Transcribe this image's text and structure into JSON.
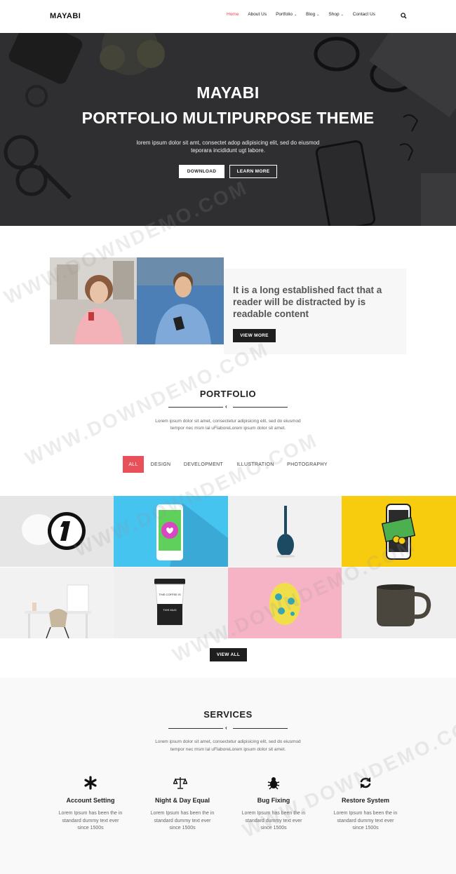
{
  "header": {
    "logo": "MAYABI",
    "nav": [
      {
        "label": "Home",
        "active": true,
        "has_caret": false
      },
      {
        "label": "About Us",
        "active": false,
        "has_caret": false
      },
      {
        "label": "Portfolio",
        "active": false,
        "has_caret": true
      },
      {
        "label": "Blog",
        "active": false,
        "has_caret": true
      },
      {
        "label": "Shop",
        "active": false,
        "has_caret": true
      },
      {
        "label": "Contact Us",
        "active": false,
        "has_caret": false
      }
    ],
    "search_icon": "search-icon",
    "caret_glyph": "⌄"
  },
  "hero": {
    "title_line1": "MAYABI",
    "title_line2": "PORTFOLIO MULTIPURPOSE THEME",
    "subtitle_line1": "lorem ipsum dolor sit amt, consectet adop adipisicing elit, sed do eiusmod",
    "subtitle_line2": "teporara incididunt ugt labore.",
    "download_label": "DOWNLOAD",
    "learn_more_label": "LEARN MORE"
  },
  "about": {
    "text": "It is a long established fact that a reader will be distracted by is readable content",
    "button_label": "VIEW MORE"
  },
  "portfolio": {
    "title": "PORTFOLIO",
    "desc_line1": "Lorem ipsum dolor sit amet, consectetur adipisicing elit, sed do eiusmod",
    "desc_line2": "tempor nec msm lal uFlaboreLorem ipsum dolor sit amet.",
    "filters": [
      "ALL",
      "DESIGN",
      "DEVELOPMENT",
      "ILLUSTRATION",
      "PHOTOGRAPHY"
    ],
    "active_filter": "ALL",
    "view_all_label": "VIEW ALL",
    "tile_colors": [
      "#e6e6e6",
      "#44c4ef",
      "#f1f1f1",
      "#f8cc0e",
      "#f2f2f2",
      "#efefef",
      "#f7b3c6",
      "#efefef"
    ]
  },
  "services": {
    "title": "SERVICES",
    "desc_line1": "Lorem ipsum dolor sit amet, consectetur adipisicing elit, sed do eiusmod",
    "desc_line2": "tempor nec msm lal uFlaboreLorem ipsum dolor sit amet.",
    "items": [
      {
        "title": "Account Setting",
        "icon": "asterisk-icon",
        "text_line1": "Lorem Ipsum has been the in",
        "text_line2": "standard dummy text ever",
        "text_line3": "since 1500s"
      },
      {
        "title": "Night & Day Equal",
        "icon": "balance-scale-icon",
        "text_line1": "Lorem Ipsum has been the in",
        "text_line2": "standard dummy text ever",
        "text_line3": "since 1500s"
      },
      {
        "title": "Bug Fixing",
        "icon": "bug-icon",
        "text_line1": "Lorem Ipsum has been the in",
        "text_line2": "standard dummy text ever",
        "text_line3": "since 1500s"
      },
      {
        "title": "Restore System",
        "icon": "refresh-icon",
        "text_line1": "Lorem Ipsum has been the in",
        "text_line2": "standard dummy text ever",
        "text_line3": "since 1500s"
      }
    ]
  },
  "watermark": "WWW.DOWNDEMO.COM",
  "colors": {
    "accent": "#e8505a",
    "dark": "#1e1e1e",
    "hero_bg": "#2f2f31"
  }
}
